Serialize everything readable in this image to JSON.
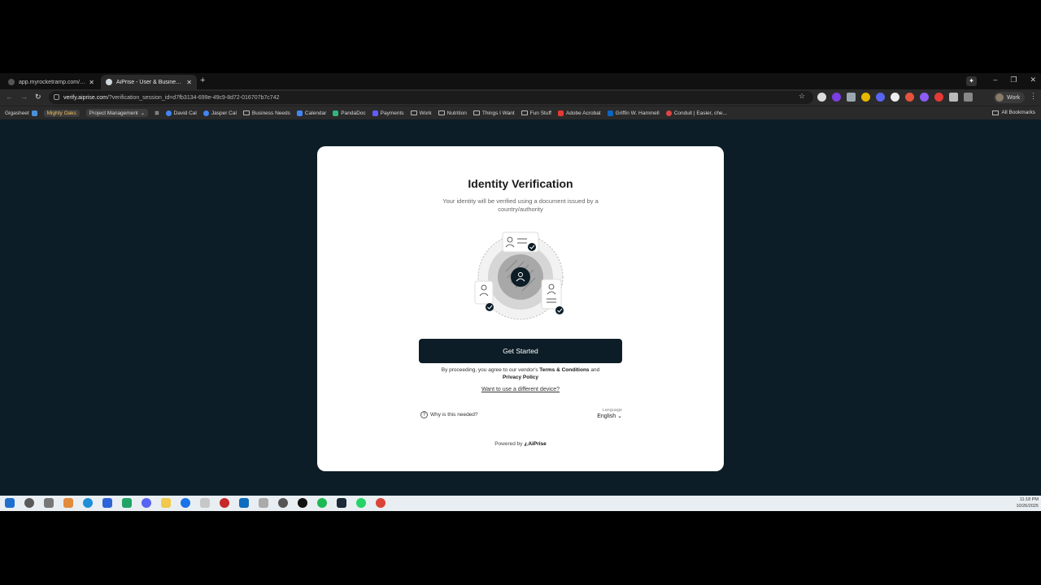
{
  "browser": {
    "tabs": [
      {
        "title": "app.myrocketramp.com/withd"
      },
      {
        "title": "AiPrise - User & Business Verif"
      }
    ],
    "url": {
      "host": "verify.aiprise.com",
      "path": "/?verification_session_id=d7fb3134-699e-49c9-8d72-016707b7c742"
    },
    "profile": "Work",
    "bookmarks": [
      {
        "label": "Gigasheet"
      },
      {
        "label": "Mighty Oaks"
      },
      {
        "label": "Project Management"
      },
      {
        "label": "David Cal"
      },
      {
        "label": "Jasper Cal"
      },
      {
        "label": "Business Needs"
      },
      {
        "label": "Calendar"
      },
      {
        "label": "PandaDoc"
      },
      {
        "label": "Payments"
      },
      {
        "label": "Work"
      },
      {
        "label": "Nutrition"
      },
      {
        "label": "Things I Want"
      },
      {
        "label": "Fun Stuff"
      },
      {
        "label": "Adobe Acrobat"
      },
      {
        "label": "Griffin W. Hammell"
      },
      {
        "label": "Conduit | Easier, che..."
      }
    ],
    "all_bookmarks": "All Bookmarks"
  },
  "page": {
    "title": "Identity Verification",
    "subtitle": "Your identity will be verified using a document issued by a country/authority",
    "cta": "Get Started",
    "legal_prefix": "By proceeding, you agree to our vendor's",
    "terms": "Terms & Conditions",
    "legal_and": "and",
    "privacy": "Privacy Policy",
    "different_device": "Want to use a different device?",
    "why": "Why is this needed?",
    "language_label": "Language",
    "language_value": "English",
    "powered_by": "Powered by",
    "brand": "AiPrise"
  },
  "taskbar": {
    "time": "11:18 PM",
    "date": "10/26/2025"
  },
  "colors": {
    "page_bg": "#0c1d27",
    "cta_bg": "#0c1d27"
  }
}
